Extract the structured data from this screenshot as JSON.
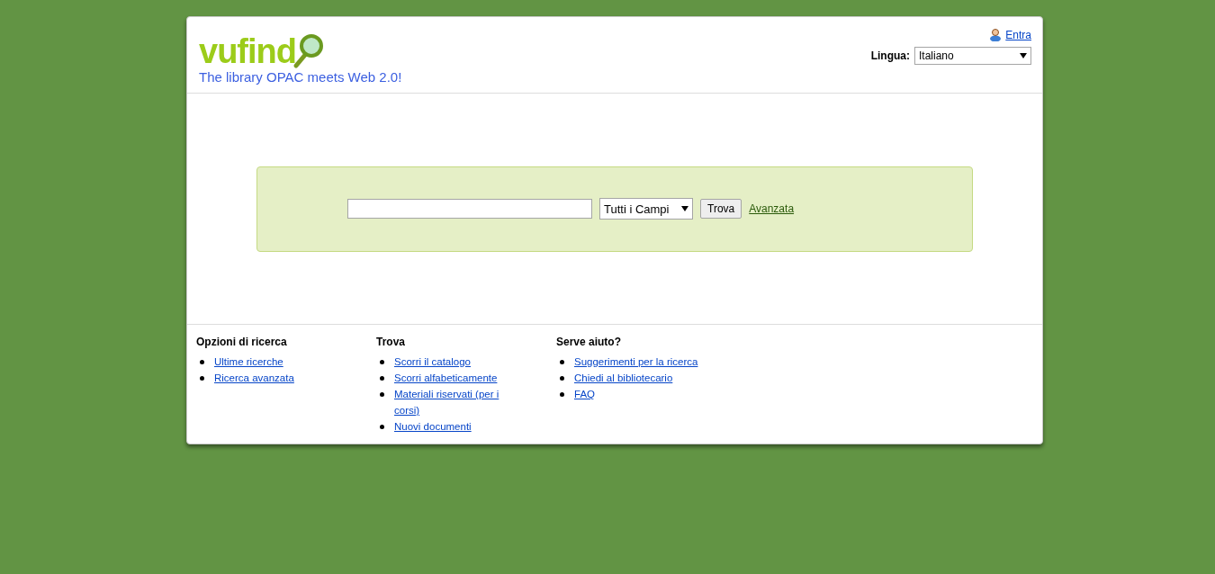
{
  "header": {
    "logo": "vufind",
    "tagline": "The library OPAC meets Web 2.0!",
    "login_link": "Entra",
    "language_label": "Lingua:",
    "language_value": "Italiano"
  },
  "search": {
    "field_type": "Tutti i Campi",
    "submit": "Trova",
    "advanced_link": "Avanzata"
  },
  "footer": [
    {
      "heading": "Opzioni di ricerca",
      "links": [
        "Ultime ricerche",
        "Ricerca avanzata"
      ]
    },
    {
      "heading": "Trova",
      "links": [
        "Scorri il catalogo",
        "Scorri alfabeticamente",
        "Materiali riservati (per i corsi)",
        "Nuovi documenti"
      ]
    },
    {
      "heading": "Serve aiuto?",
      "links": [
        "Suggerimenti per la ricerca",
        "Chiedi al bibliotecario",
        "FAQ"
      ]
    }
  ]
}
